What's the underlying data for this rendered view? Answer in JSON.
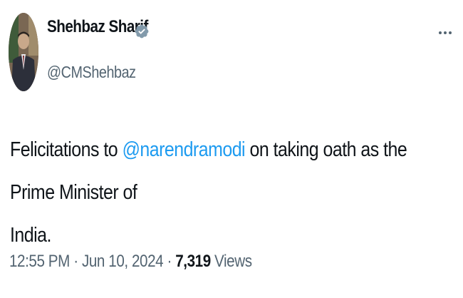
{
  "author": {
    "display_name": "Shehbaz Sharif",
    "handle": "@CMShehbaz",
    "verified_icon": "verified-badge-icon",
    "avatar": "profile-photo"
  },
  "menu": {
    "icon": "more-options-icon"
  },
  "tweet": {
    "text_before": "Felicitations to ",
    "mention": "@narendramodi",
    "text_after_line1": " on taking oath as the Prime Minister of",
    "text_line2": "India."
  },
  "meta": {
    "time": "12:55 PM",
    "separator": "·",
    "date": "Jun 10, 2024",
    "views_count": "7,319",
    "views_label": "Views"
  },
  "colors": {
    "link": "#1d9bf0",
    "secondary": "#536471",
    "primary": "#0f1419",
    "verified": "#829aab"
  }
}
